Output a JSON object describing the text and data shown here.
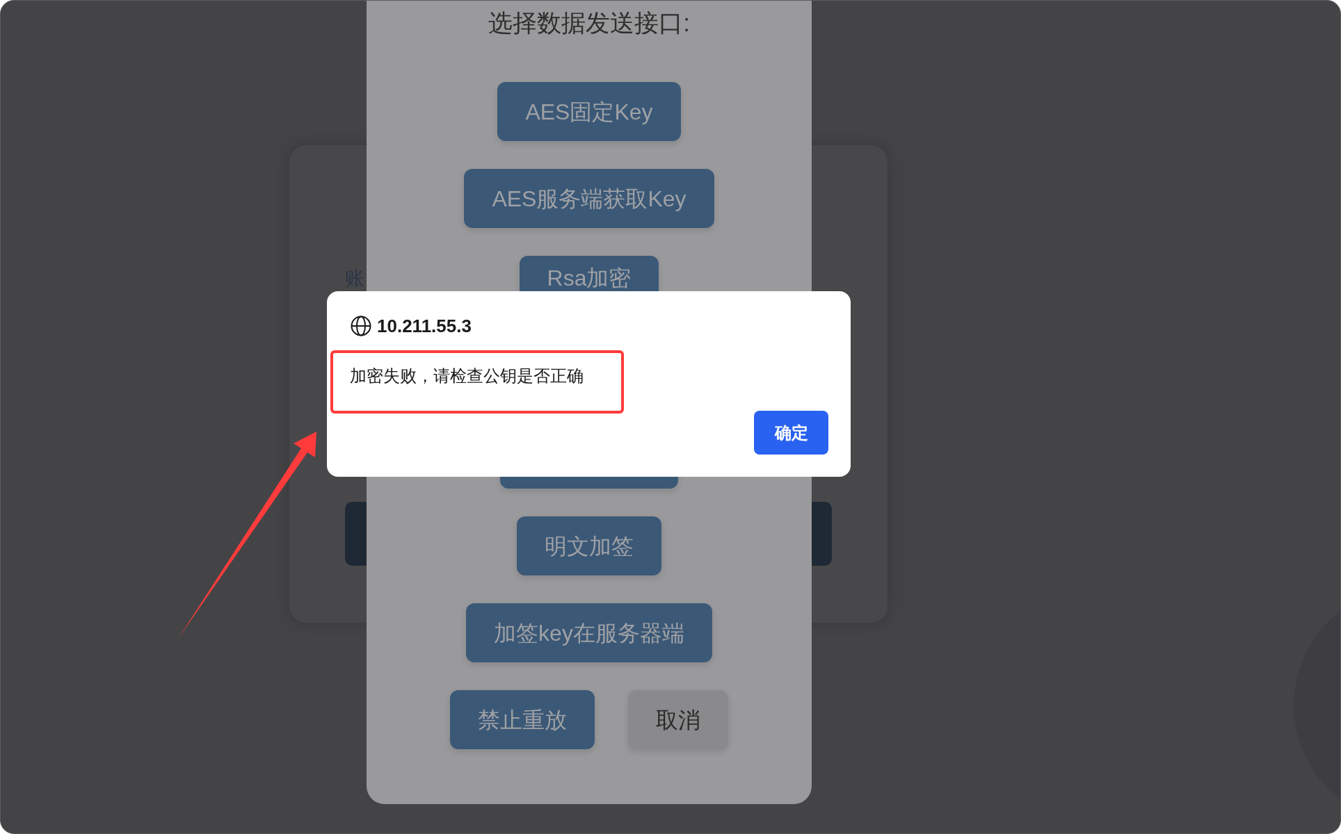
{
  "form_card": {
    "field_label": "账"
  },
  "interface_dialog": {
    "title": "选择数据发送接口:",
    "buttons": [
      {
        "kind": "labeled",
        "label": "AES固定Key"
      },
      {
        "kind": "labeled",
        "label": "AES服务端获取Key"
      },
      {
        "kind": "cut_off",
        "label": "Rsa加密"
      },
      {
        "kind": "covered"
      },
      {
        "kind": "labeled",
        "label": "明文加签"
      },
      {
        "kind": "labeled",
        "label": "加签key在服务器端"
      }
    ],
    "actions": [
      {
        "kind": "primary",
        "label": "禁止重放"
      },
      {
        "kind": "secondary",
        "label": "取消"
      }
    ]
  },
  "alert": {
    "origin": "10.211.55.3",
    "message": "加密失败，请检查公钥是否正确",
    "confirm": "确定"
  },
  "annotations": {
    "message_outlined": true,
    "arrow": true
  }
}
